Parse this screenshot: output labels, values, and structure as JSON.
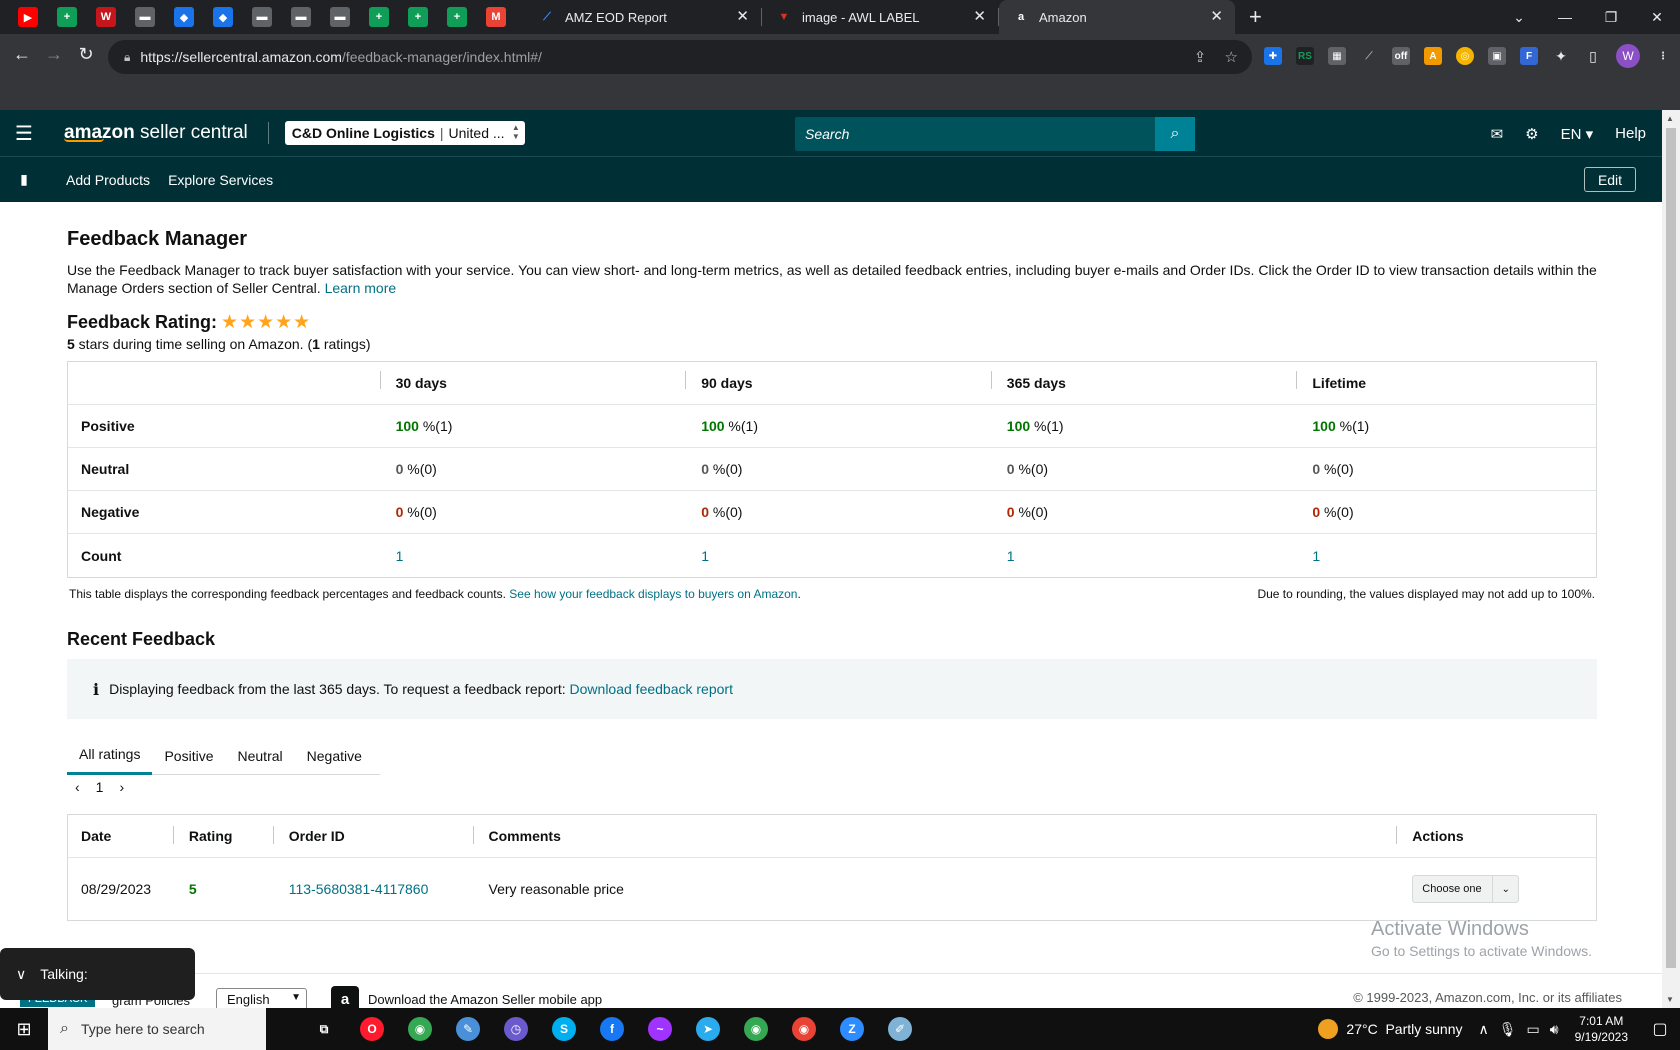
{
  "browser": {
    "pinned_tabs": [
      {
        "icon": "youtube-icon",
        "glyph": "▶",
        "color": "#ff0000"
      },
      {
        "icon": "sheets-icon",
        "glyph": "+",
        "color": "#0f9d58"
      },
      {
        "icon": "w-icon",
        "glyph": "W",
        "color": "#c4161c"
      },
      {
        "icon": "doc-icon",
        "glyph": "▬",
        "color": "#5f6368"
      },
      {
        "icon": "diamond-icon",
        "glyph": "◆",
        "color": "#1a73e8"
      },
      {
        "icon": "diamond-icon",
        "glyph": "◆",
        "color": "#1a73e8"
      },
      {
        "icon": "doc-icon",
        "glyph": "▬",
        "color": "#5f6368"
      },
      {
        "icon": "doc-icon",
        "glyph": "▬",
        "color": "#5f6368"
      },
      {
        "icon": "doc-icon",
        "glyph": "▬",
        "color": "#5f6368"
      },
      {
        "icon": "sheets-icon",
        "glyph": "+",
        "color": "#0f9d58"
      },
      {
        "icon": "sheets-icon",
        "glyph": "+",
        "color": "#0f9d58"
      },
      {
        "icon": "sheets-icon",
        "glyph": "+",
        "color": "#0f9d58"
      },
      {
        "icon": "gmail-icon",
        "glyph": "M",
        "color": "#ea4335"
      }
    ],
    "tabs": [
      {
        "title": "AMZ EOD Report",
        "icon": "slides-icon",
        "color": "#4285f4",
        "glyph": "⟋"
      },
      {
        "title": "image - AWL LABEL",
        "icon": "tab-red-icon",
        "color": "#d93025",
        "glyph": "▼"
      },
      {
        "title": "Amazon",
        "icon": "amazon-icon",
        "color": "#fff",
        "glyph": "a"
      }
    ],
    "url_host": "https://sellercentral.amazon.com",
    "url_path": "/feedback-manager/index.html#/"
  },
  "header": {
    "logo_main": "amazon",
    "logo_sub": " seller central",
    "account": "C&D Online Logistics",
    "account_region": "United ...",
    "search_placeholder": "Search",
    "lang": "EN",
    "help": "Help"
  },
  "nav": {
    "items": [
      "Add Products",
      "Explore Services"
    ],
    "edit": "Edit"
  },
  "page": {
    "title": "Feedback Manager",
    "intro": "Use the Feedback Manager to track buyer satisfaction with your service. You can view short- and long-term metrics, as well as detailed feedback entries, including buyer e-mails and Order IDs. Click the Order ID to view transaction details within the Manage Orders section of Seller Central.",
    "learn_more": "Learn more",
    "rating_label": "Feedback Rating:",
    "stars": "★★★★★",
    "rating_value": "5",
    "rating_mid": " stars during time selling on Amazon. (",
    "rating_count": "1",
    "rating_end": " ratings)"
  },
  "feedback_table": {
    "columns": [
      "30 days",
      "90 days",
      "365 days",
      "Lifetime"
    ],
    "rows": [
      {
        "label": "Positive",
        "tone": "g",
        "cells": [
          [
            "100",
            " %(1)"
          ],
          [
            "100",
            " %(1)"
          ],
          [
            "100",
            " %(1)"
          ],
          [
            "100",
            " %(1)"
          ]
        ]
      },
      {
        "label": "Neutral",
        "tone": "n",
        "cells": [
          [
            "0",
            " %(0)"
          ],
          [
            "0",
            " %(0)"
          ],
          [
            "0",
            " %(0)"
          ],
          [
            "0",
            " %(0)"
          ]
        ]
      },
      {
        "label": "Negative",
        "tone": "r",
        "cells": [
          [
            "0",
            " %(0)"
          ],
          [
            "0",
            " %(0)"
          ],
          [
            "0",
            " %(0)"
          ],
          [
            "0",
            " %(0)"
          ]
        ]
      },
      {
        "label": "Count",
        "tone": "",
        "cells": [
          [
            "1",
            ""
          ],
          [
            "1",
            ""
          ],
          [
            "1",
            ""
          ],
          [
            "1",
            ""
          ]
        ]
      }
    ],
    "note_left": "This table displays the corresponding feedback percentages and feedback counts.",
    "note_link": "See how your feedback displays to buyers on Amazon",
    "note_right": "Due to rounding, the values displayed may not add up to 100%."
  },
  "recent": {
    "title": "Recent Feedback",
    "info": "Displaying feedback from the last 365 days. To request a feedback report:",
    "info_link": "Download feedback report",
    "tabs": [
      "All ratings",
      "Positive",
      "Neutral",
      "Negative"
    ],
    "page": "1",
    "headers": {
      "date": "Date",
      "rating": "Rating",
      "order": "Order ID",
      "comments": "Comments",
      "actions": "Actions"
    },
    "rows": [
      {
        "date": "08/29/2023",
        "rating": "5",
        "order": "113-5680381-4117860",
        "comment": "Very reasonable price",
        "action": "Choose one"
      }
    ]
  },
  "footer": {
    "feedback_tab": "FEEDBACK",
    "policies": "gram Policies",
    "language": "English",
    "app": "Download the Amazon Seller mobile app",
    "copyright": "© 1999-2023, Amazon.com, Inc. or its affiliates"
  },
  "overlay": {
    "activate_title": "Activate Windows",
    "activate_sub": "Go to Settings to activate Windows.",
    "talking": "Talking:"
  },
  "taskbar": {
    "search_placeholder": "Type here to search",
    "temp": "27°C",
    "weather": "Partly sunny",
    "time": "7:01 AM",
    "date": "9/19/2023",
    "apps": [
      {
        "icon": "task-view-icon",
        "glyph": "⧉",
        "color": "#101010"
      },
      {
        "icon": "opera-icon",
        "glyph": "O",
        "color": "#ff1b2d"
      },
      {
        "icon": "chrome-icon",
        "glyph": "◉",
        "color": "#34a853"
      },
      {
        "icon": "paint-icon",
        "glyph": "✎",
        "color": "#4a90d9"
      },
      {
        "icon": "clock-app-icon",
        "glyph": "◷",
        "color": "#6a5acd"
      },
      {
        "icon": "skype-icon",
        "glyph": "S",
        "color": "#00aff0"
      },
      {
        "icon": "facebook-icon",
        "glyph": "f",
        "color": "#1877f2"
      },
      {
        "icon": "messenger-icon",
        "glyph": "~",
        "color": "#a033ff"
      },
      {
        "icon": "telegram-icon",
        "glyph": "➤",
        "color": "#2aabee"
      },
      {
        "icon": "chrome-profile-icon",
        "glyph": "◉",
        "color": "#34a853"
      },
      {
        "icon": "chrome-profile-icon",
        "glyph": "◉",
        "color": "#ea4335"
      },
      {
        "icon": "zoom-icon",
        "glyph": "Z",
        "color": "#2d8cff"
      },
      {
        "icon": "notepad-icon",
        "glyph": "✐",
        "color": "#7fb3d5"
      }
    ]
  }
}
